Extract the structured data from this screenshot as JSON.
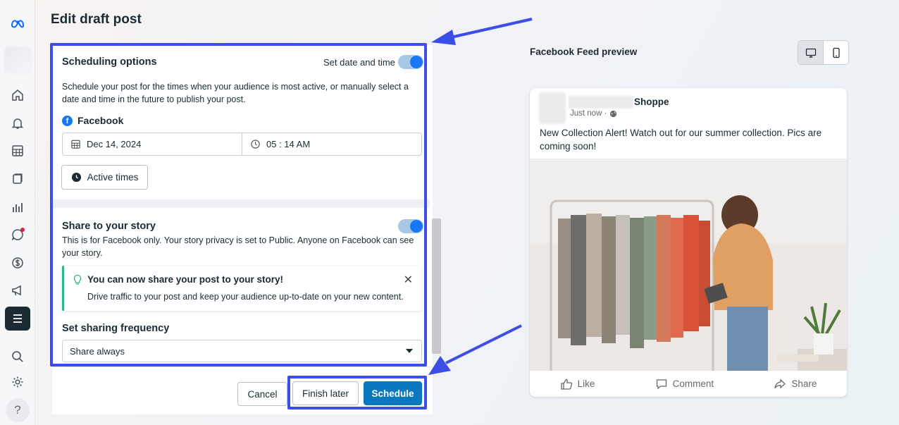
{
  "page": {
    "title": "Edit draft post"
  },
  "scheduling": {
    "title": "Scheduling options",
    "toggle_label": "Set date and time",
    "description": "Schedule your post for the times when your audience is most active, or manually select a date and time in the future to publish your post.",
    "platform": "Facebook",
    "date": "Dec 14, 2024",
    "time": "05 : 14 AM",
    "active_times_label": "Active times"
  },
  "story": {
    "title": "Share to your story",
    "description": "This is for Facebook only. Your story privacy is set to Public. Anyone on Facebook can see your story.",
    "tip_title": "You can now share your post to your story!",
    "tip_body": "Drive traffic to your post and keep your audience up-to-date on your new content."
  },
  "frequency": {
    "label": "Set sharing frequency",
    "value": "Share always"
  },
  "footer": {
    "cancel": "Cancel",
    "finish_later": "Finish later",
    "schedule": "Schedule"
  },
  "preview": {
    "title": "Facebook Feed preview",
    "page_name": "Shoppe",
    "timestamp": "Just now ·",
    "caption": "New Collection Alert! Watch out for our summer collection. Pics are coming soon!",
    "actions": {
      "like": "Like",
      "comment": "Comment",
      "share": "Share"
    }
  },
  "colors": {
    "accent": "#1877f2",
    "primary_button": "#0a78be",
    "annotation": "#3b4ee8",
    "tip_border": "#2bb58e"
  },
  "icons": [
    "meta-logo-icon",
    "home-icon",
    "bell-icon",
    "calendar-grid-icon",
    "content-icon",
    "insights-icon",
    "inbox-icon",
    "monetization-icon",
    "ads-icon",
    "menu-icon",
    "search-icon",
    "settings-icon",
    "help-icon"
  ]
}
